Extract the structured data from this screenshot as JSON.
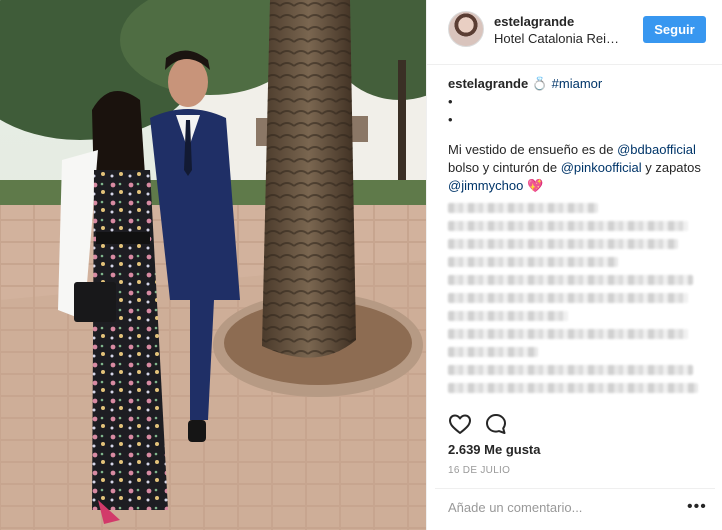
{
  "post": {
    "author": {
      "username": "estelagrande",
      "location": "Hotel Catalonia Rei…"
    },
    "follow_label": "Seguir",
    "caption": {
      "username": "estelagrande",
      "ring_emoji": "💍",
      "hashtag": "#miamor",
      "bullet_1": "•",
      "bullet_2": "•",
      "text_1": "Mi vestido de ensueño es de ",
      "mention_1": "@bdbaofficial",
      "text_2": " bolso y cinturón de ",
      "mention_2": "@pinkoofficial",
      "text_3": " y zapatos ",
      "mention_3": "@jimmychoo",
      "heart_emoji": "💖"
    },
    "likes_text": "2.639 Me gusta",
    "date": "16 DE JULIO",
    "comment_placeholder": "Añade un comentario...",
    "more_label": "•••"
  },
  "icons": {
    "like": "heart-icon",
    "comment": "comment-icon"
  },
  "colors": {
    "follow_button": "#3897f0",
    "link": "#003569",
    "muted": "#999999"
  }
}
